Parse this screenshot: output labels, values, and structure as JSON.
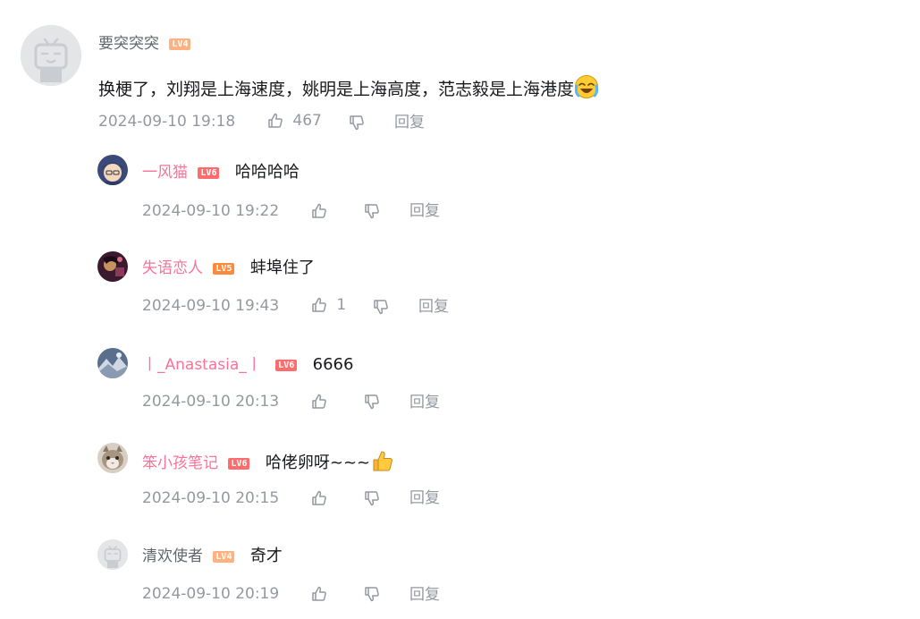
{
  "main_comment": {
    "username": "要突突突",
    "level": "LV4",
    "level_color": "#ffb27f",
    "text": "换梗了，刘翔是上海速度，姚明是上海高度，范志毅是上海港度",
    "emoji_icon": "laughing-crying-emoji-icon",
    "time": "2024-09-10 19:18",
    "likes": "467",
    "reply_label": "回复"
  },
  "replies": [
    {
      "username": "一风猫",
      "level": "LV6",
      "level_color": "#ff6c6c",
      "vip": true,
      "text": "哈哈哈哈",
      "time": "2024-09-10 19:22",
      "likes": "",
      "reply_label": "回复"
    },
    {
      "username": "失语恋人",
      "level": "LV5",
      "level_color": "#ff8a3c",
      "vip": true,
      "text": "蚌埠住了",
      "time": "2024-09-10 19:43",
      "likes": "1",
      "reply_label": "回复"
    },
    {
      "username": "丨_Anastasia_丨",
      "level": "LV6",
      "level_color": "#ff6c6c",
      "vip": true,
      "text": "6666",
      "time": "2024-09-10 20:13",
      "likes": "",
      "reply_label": "回复"
    },
    {
      "username": "笨小孩笔记",
      "level": "LV6",
      "level_color": "#ff6c6c",
      "vip": true,
      "text": "哈佬卵呀~~~",
      "time": "2024-09-10 20:15",
      "likes": "",
      "reply_label": "回复"
    },
    {
      "username": "清欢使者",
      "level": "LV4",
      "level_color": "#ffb27f",
      "vip": false,
      "text": "奇才",
      "time": "2024-09-10 20:19",
      "likes": "",
      "reply_label": "回复"
    }
  ],
  "colors": {
    "vip_name": "#fb7299",
    "normal_name": "#61666d",
    "meta": "#9499a0"
  }
}
